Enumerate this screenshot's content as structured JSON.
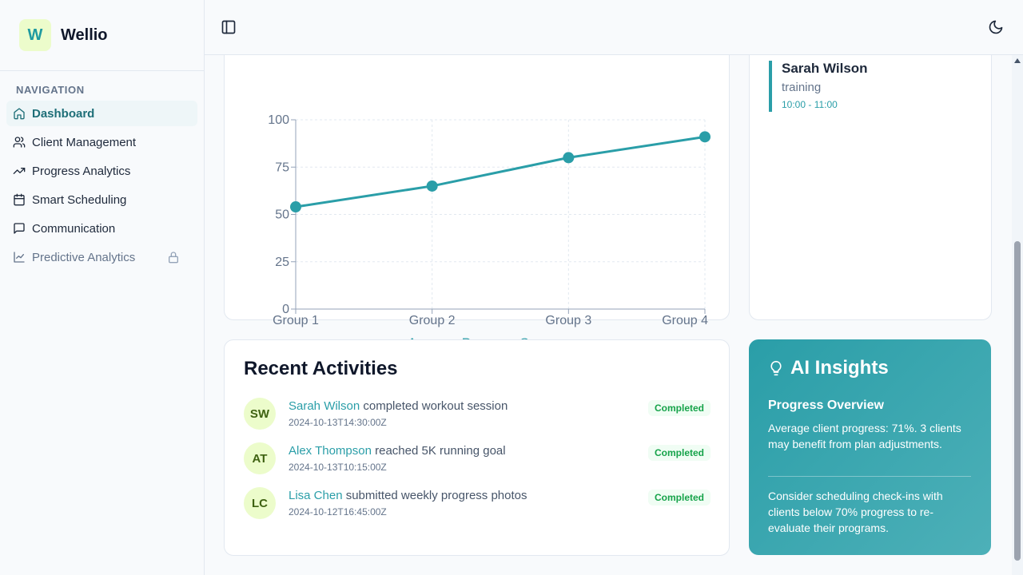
{
  "brand": {
    "logo_letter": "W",
    "name": "Wellio"
  },
  "sidebar": {
    "section_title": "NAVIGATION",
    "items": [
      {
        "label": "Dashboard",
        "icon": "home-icon",
        "active": true
      },
      {
        "label": "Client Management",
        "icon": "users-icon"
      },
      {
        "label": "Progress Analytics",
        "icon": "trending-up-icon"
      },
      {
        "label": "Smart Scheduling",
        "icon": "calendar-icon"
      },
      {
        "label": "Communication",
        "icon": "message-icon"
      },
      {
        "label": "Predictive Analytics",
        "icon": "line-chart-icon",
        "locked": true
      }
    ]
  },
  "topbar": {
    "left_icon": "sidebar-toggle-icon",
    "right_icon": "moon-icon"
  },
  "chart_data": {
    "type": "line",
    "categories": [
      "Group 1",
      "Group 2",
      "Group 3",
      "Group 4"
    ],
    "series": [
      {
        "name": "Average Progress Score",
        "values": [
          54,
          65,
          80,
          91
        ]
      }
    ],
    "yticks": [
      "0",
      "25",
      "50",
      "75",
      "100"
    ],
    "ylim": [
      0,
      100
    ],
    "grid": true,
    "legend": "bottom",
    "color": "#2a9ea8"
  },
  "schedule": {
    "entries": [
      {
        "name": "Sarah Wilson",
        "type": "training",
        "time": "10:00 - 11:00"
      }
    ]
  },
  "activities": {
    "title": "Recent Activities",
    "items": [
      {
        "initials": "SW",
        "user": "Sarah Wilson",
        "action": "completed workout session",
        "timestamp": "2024-10-13T14:30:00Z",
        "status": "Completed"
      },
      {
        "initials": "AT",
        "user": "Alex Thompson",
        "action": "reached 5K running goal",
        "timestamp": "2024-10-13T10:15:00Z",
        "status": "Completed"
      },
      {
        "initials": "LC",
        "user": "Lisa Chen",
        "action": "submitted weekly progress photos",
        "timestamp": "2024-10-12T16:45:00Z",
        "status": "Completed"
      }
    ]
  },
  "ai_insights": {
    "title": "AI Insights",
    "subtitle": "Progress Overview",
    "text1": "Average client progress: 71%. 3 clients may benefit from plan adjustments.",
    "text2": "Consider scheduling check-ins with clients below 70% progress to re-evaluate their programs."
  }
}
